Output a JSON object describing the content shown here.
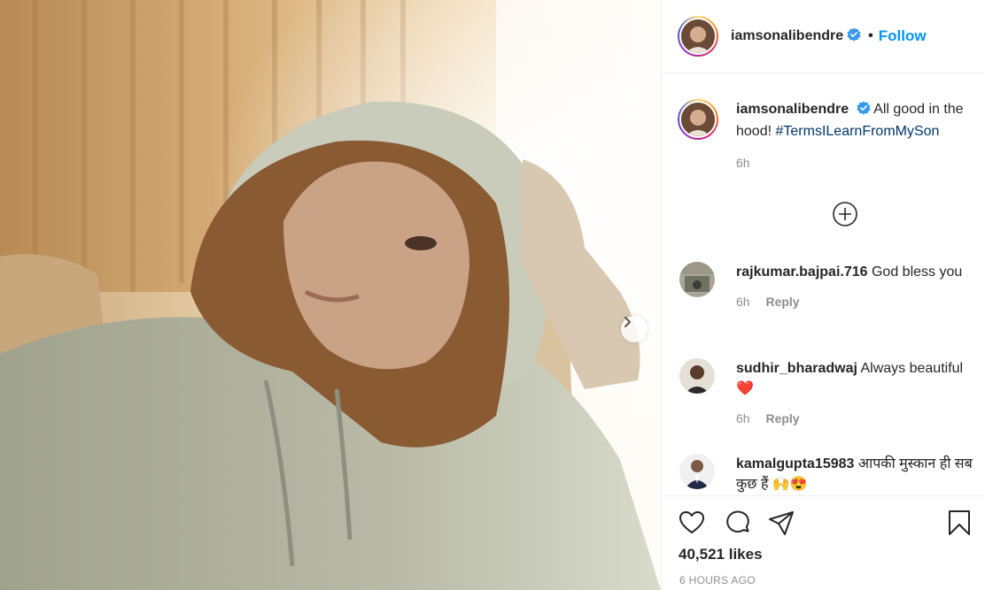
{
  "post": {
    "username": "iamsonalibendre",
    "follow_label": "Follow",
    "dot": "•",
    "caption_text": "All good in the hood!",
    "caption_hashtag": "#TermsILearnFromMySon",
    "caption_time": "6h",
    "likes": "40,521 likes",
    "posted_ago": "6 HOURS AGO"
  },
  "comments": [
    {
      "username": "rajkumar.bajpai.716",
      "text": "God bless you",
      "time": "6h",
      "reply_label": "Reply"
    },
    {
      "username": "sudhir_bharadwaj",
      "text": "Always beautiful❤️",
      "time": "6h",
      "reply_label": "Reply"
    },
    {
      "username": "kamalgupta15983",
      "text": "आपकी मुस्कान ही सब कुछ हैं 🙌😍"
    }
  ],
  "icons": {
    "verified": "verified-badge-icon",
    "add_comments": "plus-circle-icon",
    "like": "heart-icon",
    "comment": "comment-icon",
    "share": "paper-plane-icon",
    "save": "bookmark-icon",
    "next": "chevron-right-icon"
  },
  "colors": {
    "follow": "#0095f6",
    "hashtag": "#00376b",
    "verified": "#3897f0",
    "muted": "#8e8e8e"
  }
}
